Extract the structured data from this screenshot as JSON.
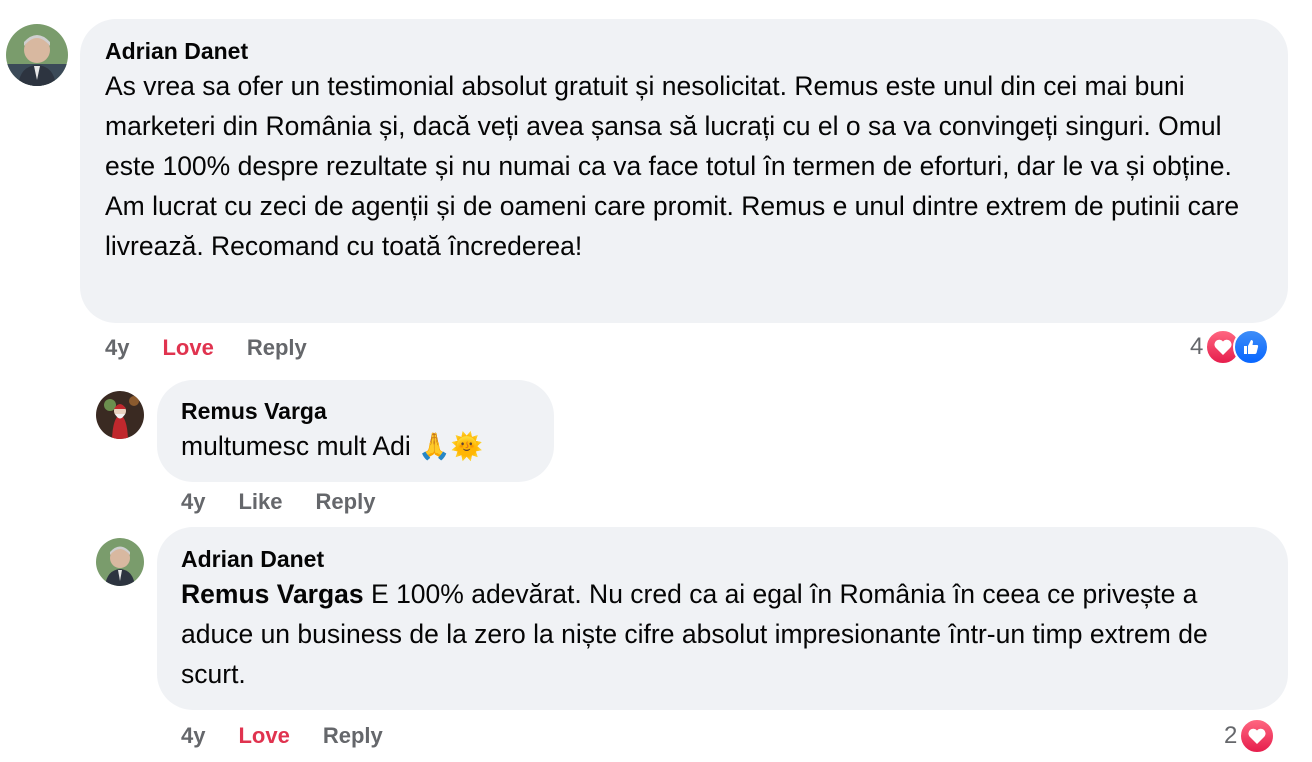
{
  "comments": [
    {
      "author": "Adrian Danet",
      "text": "As vrea sa ofer un testimonial absolut gratuit și nesolicitat. Remus este unul din cei mai buni marketeri din România și, dacă veți avea șansa să lucrați cu el o sa va convingeți singuri. Omul este 100% despre rezultate și nu numai ca va face totul în termen de eforturi, dar le va și obține. Am lucrat cu zeci de agenții și de oameni care promit. Remus e unul dintre extrem de putinii care livrează. Recomand cu toată încrederea!",
      "time": "4y",
      "reaction_label": "Love",
      "reply_label": "Reply",
      "reaction_count": "4",
      "reaction_icons": [
        "heart-icon",
        "like-icon"
      ]
    },
    {
      "author": "Remus Varga",
      "text": "multumesc mult Adi",
      "emojis": "🙏🌞",
      "time": "4y",
      "reaction_label": "Like",
      "reply_label": "Reply"
    },
    {
      "author": "Adrian Danet",
      "mention": "Remus Vargas",
      "text": "E 100% adevărat. Nu cred ca ai egal în România în ceea ce privește a aduce un business de la zero la niște cifre absolut impresionante într-un timp extrem de scurt.",
      "time": "4y",
      "reaction_label": "Love",
      "reply_label": "Reply",
      "reaction_count": "2",
      "reaction_icons": [
        "heart-icon"
      ]
    }
  ],
  "colors": {
    "bubble": "#f0f2f5",
    "love": "#e0334f",
    "meta": "#65676b",
    "like": "#0866ff"
  }
}
